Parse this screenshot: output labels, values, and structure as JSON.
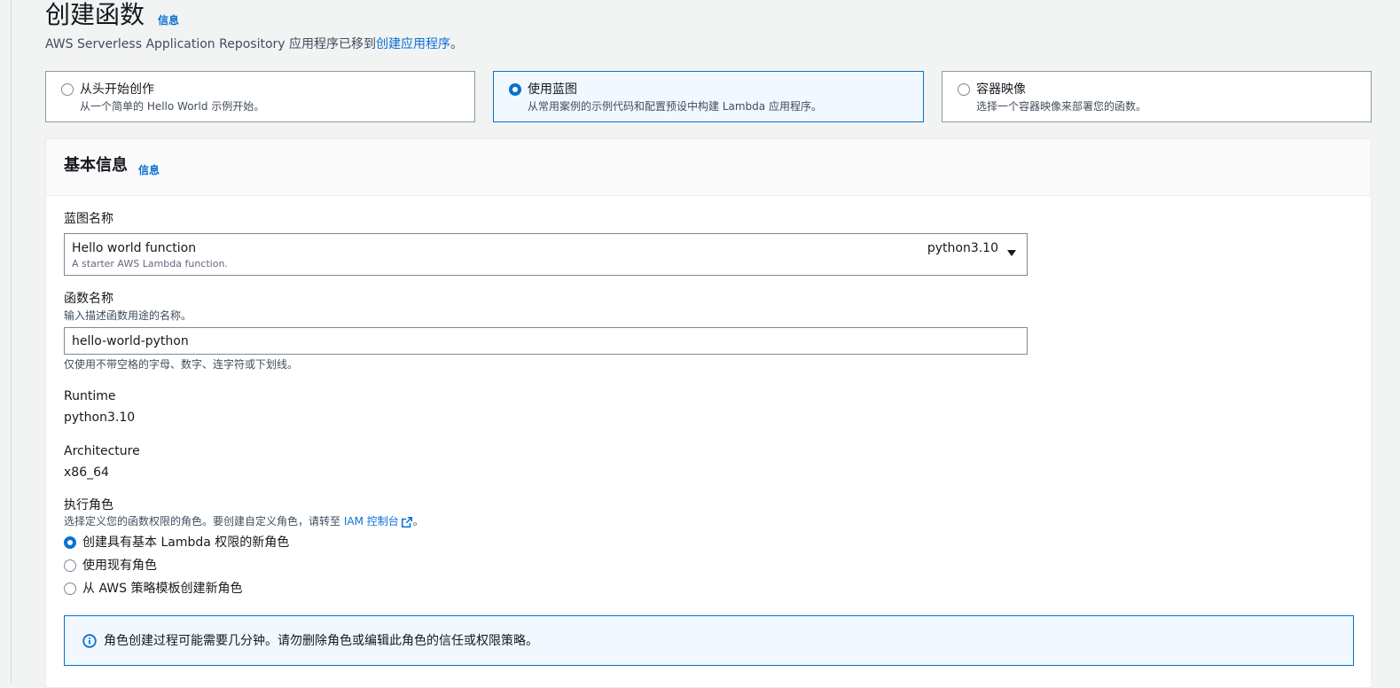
{
  "page": {
    "title": "创建函数",
    "info_label": "信息",
    "subtitle_text": "AWS Serverless Application Repository 应用程序已移到",
    "subtitle_link": "创建应用程序",
    "subtitle_end": "。"
  },
  "options": [
    {
      "title": "从头开始创作",
      "desc": "从一个简单的 Hello World 示例开始。",
      "selected": false
    },
    {
      "title": "使用蓝图",
      "desc": "从常用案例的示例代码和配置预设中构建 Lambda 应用程序。",
      "selected": true
    },
    {
      "title": "容器映像",
      "desc": "选择一个容器映像来部署您的函数。",
      "selected": false
    }
  ],
  "basic_info": {
    "title": "基本信息",
    "info_label": "信息",
    "blueprint": {
      "label": "蓝图名称",
      "name": "Hello world function",
      "desc": "A starter AWS Lambda function.",
      "runtime": "python3.10"
    },
    "function_name": {
      "label": "函数名称",
      "desc": "输入描述函数用途的名称。",
      "value": "hello-world-python",
      "hint": "仅使用不带空格的字母、数字、连字符或下划线。"
    },
    "runtime": {
      "label": "Runtime",
      "value": "python3.10"
    },
    "architecture": {
      "label": "Architecture",
      "value": "x86_64"
    },
    "role": {
      "label": "执行角色",
      "desc_before": "选择定义您的函数权限的角色。要创建自定义角色，请转至 ",
      "desc_link": "IAM 控制台",
      "desc_after": "。",
      "options": [
        {
          "label": "创建具有基本 Lambda 权限的新角色",
          "selected": true
        },
        {
          "label": "使用现有角色",
          "selected": false
        },
        {
          "label": "从 AWS 策略模板创建新角色",
          "selected": false
        }
      ]
    },
    "alert_text": "角色创建过程可能需要几分钟。请勿删除角色或编辑此角色的信任或权限策略。"
  },
  "colors": {
    "accent": "#0972d3",
    "selected_bg": "#f1f8ff",
    "page_bg": "#f2f3f3"
  },
  "icons": {
    "info": "info-circle-icon",
    "external": "external-link-icon",
    "caret": "caret-down-icon"
  }
}
